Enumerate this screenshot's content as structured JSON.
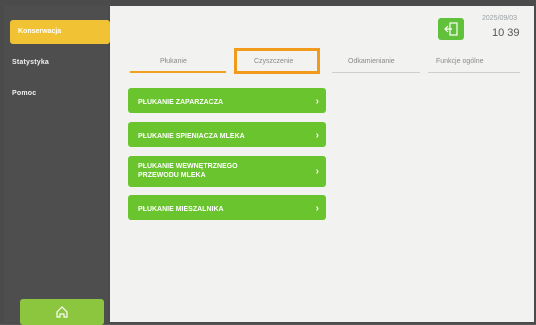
{
  "sidebar": {
    "items": [
      {
        "label": "Konserwacja",
        "active": true
      },
      {
        "label": "Statystyka",
        "active": false
      },
      {
        "label": "Pomoc",
        "active": false
      }
    ],
    "home_icon": "home-icon"
  },
  "header": {
    "date": "2025/09/03",
    "time": "10 39",
    "logout_icon": "logout-icon"
  },
  "tabs": [
    {
      "label": "Płukanie",
      "active": true
    },
    {
      "label": "Czyszczenie",
      "active": false,
      "highlighted": true
    },
    {
      "label": "Odkamienianie",
      "active": false
    },
    {
      "label": "Funkcje ogólne",
      "active": false
    }
  ],
  "buttons": [
    {
      "label": "PŁUKANIE ZAPARZACZA"
    },
    {
      "label": "PŁUKANIE SPIENIACZA MLEKA"
    },
    {
      "label": "PŁUKANIE WEWNĘTRZNEGO PRZEWODU MLEKA"
    },
    {
      "label": "PŁUKANIE MIESZALNIKA"
    }
  ],
  "colors": {
    "accent": "#f1c233",
    "button": "#69c42d",
    "highlight": "#f29a1c"
  }
}
